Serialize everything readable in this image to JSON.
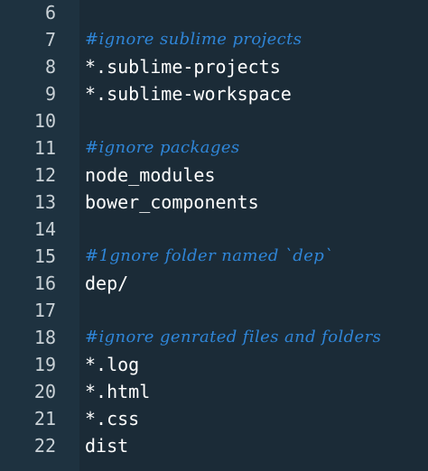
{
  "editor": {
    "lines": [
      {
        "num": "6",
        "text": "",
        "type": "blank"
      },
      {
        "num": "7",
        "text": "#ignore sublime projects",
        "type": "comment"
      },
      {
        "num": "8",
        "text": "*.sublime-projects",
        "type": "code"
      },
      {
        "num": "9",
        "text": "*.sublime-workspace",
        "type": "code"
      },
      {
        "num": "10",
        "text": "",
        "type": "blank"
      },
      {
        "num": "11",
        "text": "#ignore packages",
        "type": "comment"
      },
      {
        "num": "12",
        "text": "node_modules",
        "type": "code"
      },
      {
        "num": "13",
        "text": "bower_components",
        "type": "code"
      },
      {
        "num": "14",
        "text": "",
        "type": "blank"
      },
      {
        "num": "15",
        "text": "#1gnore folder named `dep`",
        "type": "comment"
      },
      {
        "num": "16",
        "text": "dep/",
        "type": "code"
      },
      {
        "num": "17",
        "text": "",
        "type": "blank"
      },
      {
        "num": "18",
        "text": "#ignore genrated files and folders",
        "type": "comment"
      },
      {
        "num": "19",
        "text": "*.log",
        "type": "code"
      },
      {
        "num": "20",
        "text": "*.html",
        "type": "code"
      },
      {
        "num": "21",
        "text": "*.css",
        "type": "code"
      },
      {
        "num": "22",
        "text": "dist",
        "type": "code"
      }
    ]
  },
  "colors": {
    "background": "#1b2b37",
    "gutter": "#1e3240",
    "line_number": "#c9d1d6",
    "code_text": "#ffffff",
    "comment": "#2f86d8"
  }
}
